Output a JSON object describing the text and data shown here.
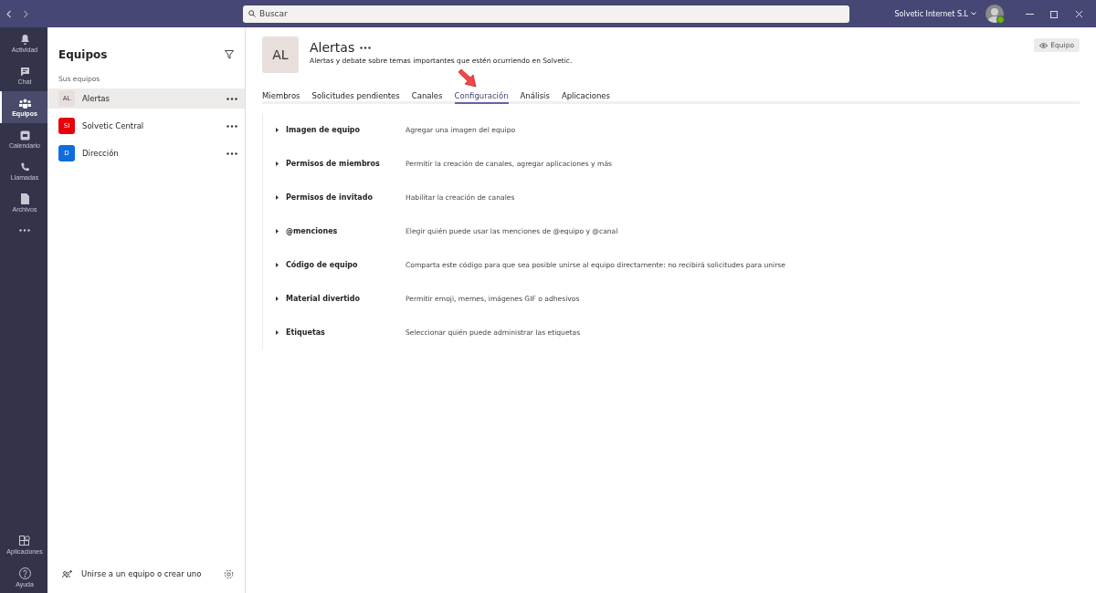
{
  "titlebar": {
    "search": {
      "placeholder": "Buscar"
    },
    "account": "Solvetic Internet S.L"
  },
  "rail": {
    "items": [
      {
        "kind": "bell",
        "label": "Actividad",
        "selected": false
      },
      {
        "kind": "chat",
        "label": "Chat",
        "selected": false
      },
      {
        "kind": "teams",
        "label": "Equipos",
        "selected": true
      },
      {
        "kind": "calendar",
        "label": "Calendario",
        "selected": false
      },
      {
        "kind": "phone",
        "label": "Llamadas",
        "selected": false
      },
      {
        "kind": "file",
        "label": "Archivos",
        "selected": false
      }
    ],
    "bottom": [
      {
        "kind": "apps",
        "label": "Aplicaciones"
      },
      {
        "kind": "help",
        "label": "Ayuda"
      }
    ]
  },
  "sidebar": {
    "title": "Equipos",
    "section": "Sus equipos",
    "teams": [
      {
        "initials": "AL",
        "name": "Alertas",
        "color": "#e8dfdc",
        "selected": true
      },
      {
        "initials": "SI",
        "name": "Solvetic Central",
        "color": "#e8000b",
        "selected": false
      },
      {
        "initials": "D",
        "name": "Dirección",
        "color": "#0f6cde",
        "selected": false
      }
    ],
    "footer": "Unirse a un equipo o crear uno"
  },
  "team": {
    "initials": "AL",
    "name": "Alertas",
    "description": "Alertas y debate sobre temas importantes que estén ocurriendo en Solvetic.",
    "view_button": "Equipo"
  },
  "tabs": [
    {
      "label": "Miembros",
      "selected": false
    },
    {
      "label": "Solicitudes pendientes",
      "selected": false
    },
    {
      "label": "Canales",
      "selected": false
    },
    {
      "label": "Configuración",
      "selected": true
    },
    {
      "label": "Análisis",
      "selected": false
    },
    {
      "label": "Aplicaciones",
      "selected": false
    }
  ],
  "settings": [
    {
      "title": "Imagen de equipo",
      "description": "Agregar una imagen del equipo"
    },
    {
      "title": "Permisos de miembros",
      "description": "Permitir la creación de canales, agregar aplicaciones y más"
    },
    {
      "title": "Permisos de invitado",
      "description": "Habilitar la creación de canales"
    },
    {
      "title": "@menciones",
      "description": "Elegir quién puede usar las menciones de @equipo y @canal"
    },
    {
      "title": "Código de equipo",
      "description": "Comparta este código para que sea posible unirse al equipo directamente: no recibirá solicitudes para unirse"
    },
    {
      "title": "Material divertido",
      "description": "Permitir emoji, memes, imágenes GIF o adhesivos"
    },
    {
      "title": "Etiquetas",
      "description": "Seleccionar quién puede administrar las etiquetas"
    }
  ]
}
